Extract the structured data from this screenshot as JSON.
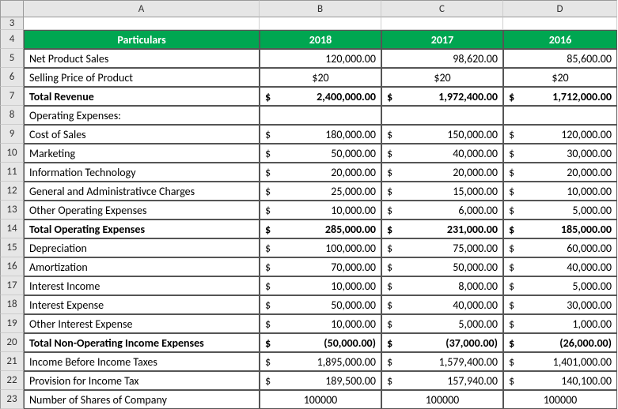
{
  "columns": [
    "A",
    "B",
    "C",
    "D"
  ],
  "row_numbers": [
    "3",
    "4",
    "5",
    "6",
    "7",
    "8",
    "9",
    "10",
    "11",
    "12",
    "13",
    "14",
    "15",
    "16",
    "17",
    "18",
    "19",
    "20",
    "21",
    "22",
    "23"
  ],
  "header": {
    "title": "Particulars",
    "y2018": "2018",
    "y2017": "2017",
    "y2016": "2016"
  },
  "rows": [
    {
      "type": "blank"
    },
    {
      "type": "header"
    },
    {
      "type": "data",
      "label": "Net Product Sales",
      "b": "120,000.00",
      "c": "98,620.00",
      "d": "85,600.00",
      "sym": "",
      "bold": false,
      "boxed": true
    },
    {
      "type": "data",
      "label": "Selling Price of Product",
      "b": "$20",
      "c": "$20",
      "d": "$20",
      "sym": "",
      "bold": false,
      "boxed": true,
      "center": true
    },
    {
      "type": "data",
      "label": "Total Revenue",
      "b": "2,400,000.00",
      "c": "1,972,400.00",
      "d": "1,712,000.00",
      "sym": "$",
      "bold": true,
      "boxed": true
    },
    {
      "type": "data",
      "label": "Operating Expenses:",
      "b": "",
      "c": "",
      "d": "",
      "sym": "",
      "bold": false,
      "boxed": true
    },
    {
      "type": "data",
      "label": "Cost of Sales",
      "b": "180,000.00",
      "c": "150,000.00",
      "d": "120,000.00",
      "sym": "$",
      "bold": false,
      "boxed": true
    },
    {
      "type": "data",
      "label": "Marketing",
      "b": "50,000.00",
      "c": "40,000.00",
      "d": "30,000.00",
      "sym": "$",
      "bold": false,
      "boxed": true
    },
    {
      "type": "data",
      "label": "Information Technology",
      "b": "20,000.00",
      "c": "20,000.00",
      "d": "20,000.00",
      "sym": "$",
      "bold": false,
      "boxed": true
    },
    {
      "type": "data",
      "label": "General and Administrativce Charges",
      "b": "25,000.00",
      "c": "15,000.00",
      "d": "10,000.00",
      "sym": "$",
      "bold": false,
      "boxed": true
    },
    {
      "type": "data",
      "label": "Other Operating Expenses",
      "b": "10,000.00",
      "c": "6,000.00",
      "d": "5,000.00",
      "sym": "$",
      "bold": false,
      "boxed": true
    },
    {
      "type": "data",
      "label": "Total Operating Expenses",
      "b": "285,000.00",
      "c": "231,000.00",
      "d": "185,000.00",
      "sym": "$",
      "bold": true,
      "boxed": true
    },
    {
      "type": "data",
      "label": "Depreciation",
      "b": "100,000.00",
      "c": "75,000.00",
      "d": "60,000.00",
      "sym": "$",
      "bold": false,
      "boxed": true
    },
    {
      "type": "data",
      "label": "Amortization",
      "b": "70,000.00",
      "c": "50,000.00",
      "d": "40,000.00",
      "sym": "$",
      "bold": false,
      "boxed": true
    },
    {
      "type": "data",
      "label": "Interest Income",
      "b": "10,000.00",
      "c": "8,000.00",
      "d": "5,000.00",
      "sym": "$",
      "bold": false,
      "boxed": true
    },
    {
      "type": "data",
      "label": "Interest Expense",
      "b": "50,000.00",
      "c": "40,000.00",
      "d": "30,000.00",
      "sym": "$",
      "bold": false,
      "boxed": true
    },
    {
      "type": "data",
      "label": "Other Interest Expense",
      "b": "10,000.00",
      "c": "5,000.00",
      "d": "1,000.00",
      "sym": "$",
      "bold": false,
      "boxed": true
    },
    {
      "type": "data",
      "label": "Total Non-Operating Income Expenses",
      "b": "(50,000.00)",
      "c": "(37,000.00)",
      "d": "(26,000.00)",
      "sym": "$",
      "bold": true,
      "boxed": true
    },
    {
      "type": "data",
      "label": "Income Before Income Taxes",
      "b": "1,895,000.00",
      "c": "1,579,400.00",
      "d": "1,401,000.00",
      "sym": "$",
      "bold": false,
      "boxed": true
    },
    {
      "type": "data",
      "label": "Provision for Income Tax",
      "b": "189,500.00",
      "c": "157,940.00",
      "d": "140,100.00",
      "sym": "$",
      "bold": false,
      "boxed": true
    },
    {
      "type": "data",
      "label": "Number of Shares of Company",
      "b": "100000",
      "c": "100000",
      "d": "100000",
      "sym": "",
      "bold": false,
      "boxed": true,
      "center": true
    }
  ]
}
